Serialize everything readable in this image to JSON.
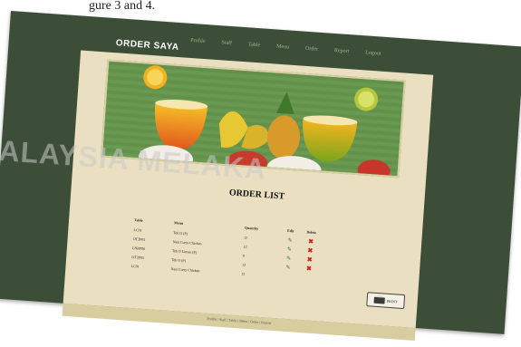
{
  "caption": "gure 3 and 4.",
  "app": {
    "title": "ORDER SAYA"
  },
  "nav": [
    "Profile",
    "Staff",
    "Table",
    "Menu",
    "Order",
    "Report",
    "Logout"
  ],
  "page_title": "ORDER LIST",
  "table": {
    "headers": [
      "Table",
      "Menu",
      "Quantity",
      "Edit",
      "Delete"
    ],
    "rows": [
      {
        "table": "LC01",
        "menu": "Teh O (P)",
        "qty": "12"
      },
      {
        "table": "OT2P02",
        "menu": "Nasi Curry Chicken",
        "qty": "12"
      },
      {
        "table": "LNRP06",
        "menu": "Teh O Limau (P)",
        "qty": "9"
      },
      {
        "table": "OT2P03",
        "menu": "Teh O (P)",
        "qty": "12"
      },
      {
        "table": "LC01",
        "menu": "Nasi Curry Chicken",
        "qty": "12"
      }
    ]
  },
  "print_label": "PRINT",
  "footer": "Profile | Staff | Table | Menu | Order | Report",
  "watermark": "ALAYSIA MELAKA",
  "colors": {
    "frame": "#3c4e37",
    "content": "#eae0c1",
    "delete": "#cc1f1f"
  }
}
